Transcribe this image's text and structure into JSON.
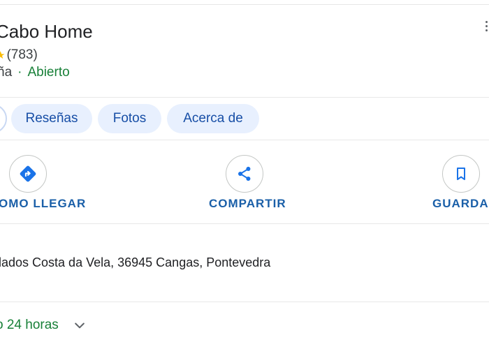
{
  "place": {
    "title": "Cabo Home",
    "rating_count": "(783)",
    "category": "ña",
    "separator": "·",
    "status": "Abierto"
  },
  "tabs": [
    {
      "label": ""
    },
    {
      "label": "Reseñas"
    },
    {
      "label": "Fotos"
    },
    {
      "label": "Acerca de"
    }
  ],
  "actions": {
    "directions_label": "OMO LLEGAR",
    "share_label": "COMPARTIR",
    "save_label": "GUARDAR"
  },
  "address": "lados Costa da Vela, 36945 Cangas, Pontevedra",
  "hours": "o 24 horas",
  "colors": {
    "accent_blue": "#1a73e8",
    "chip_bg": "#e8f0fe",
    "open_green": "#188038",
    "star": "#fbbc04"
  },
  "icons": {
    "more": "more-vertical-icon",
    "star": "star-icon",
    "directions": "directions-icon",
    "share": "share-icon",
    "save": "bookmark-icon",
    "chevron": "chevron-down-icon"
  }
}
